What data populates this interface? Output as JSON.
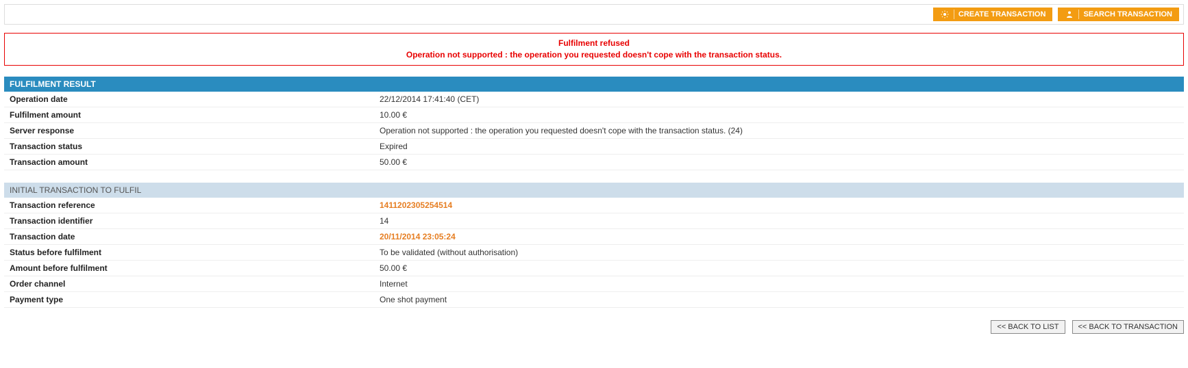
{
  "topbar": {
    "create_label": "CREATE TRANSACTION",
    "search_label": "SEARCH TRANSACTION"
  },
  "alert": {
    "title": "Fulfilment refused",
    "message": "Operation not supported : the operation you requested doesn't cope with the transaction status."
  },
  "result": {
    "header": "FULFILMENT RESULT",
    "operation_date_label": "Operation date",
    "operation_date": "22/12/2014 17:41:40 (CET)",
    "fulfilment_amount_label": "Fulfilment amount",
    "fulfilment_amount": "10.00  €",
    "server_response_label": "Server response",
    "server_response": "Operation not supported : the operation you requested doesn't cope with the transaction status. (24)",
    "transaction_status_label": "Transaction status",
    "transaction_status": "Expired",
    "transaction_amount_label": "Transaction amount",
    "transaction_amount": "50.00  €"
  },
  "initial": {
    "header": "INITIAL TRANSACTION TO FULFIL",
    "transaction_reference_label": "Transaction reference",
    "transaction_reference": "1411202305254514",
    "transaction_identifier_label": "Transaction identifier",
    "transaction_identifier": "14",
    "transaction_date_label": "Transaction date",
    "transaction_date": "20/11/2014 23:05:24",
    "status_before_label": "Status before fulfilment",
    "status_before": "To be validated (without authorisation)",
    "amount_before_label": "Amount before fulfilment",
    "amount_before": "50.00  €",
    "order_channel_label": "Order channel",
    "order_channel": "Internet",
    "payment_type_label": "Payment type",
    "payment_type": "One shot payment"
  },
  "footer": {
    "back_list": "<< BACK TO LIST",
    "back_transaction": "<< BACK TO TRANSACTION"
  }
}
